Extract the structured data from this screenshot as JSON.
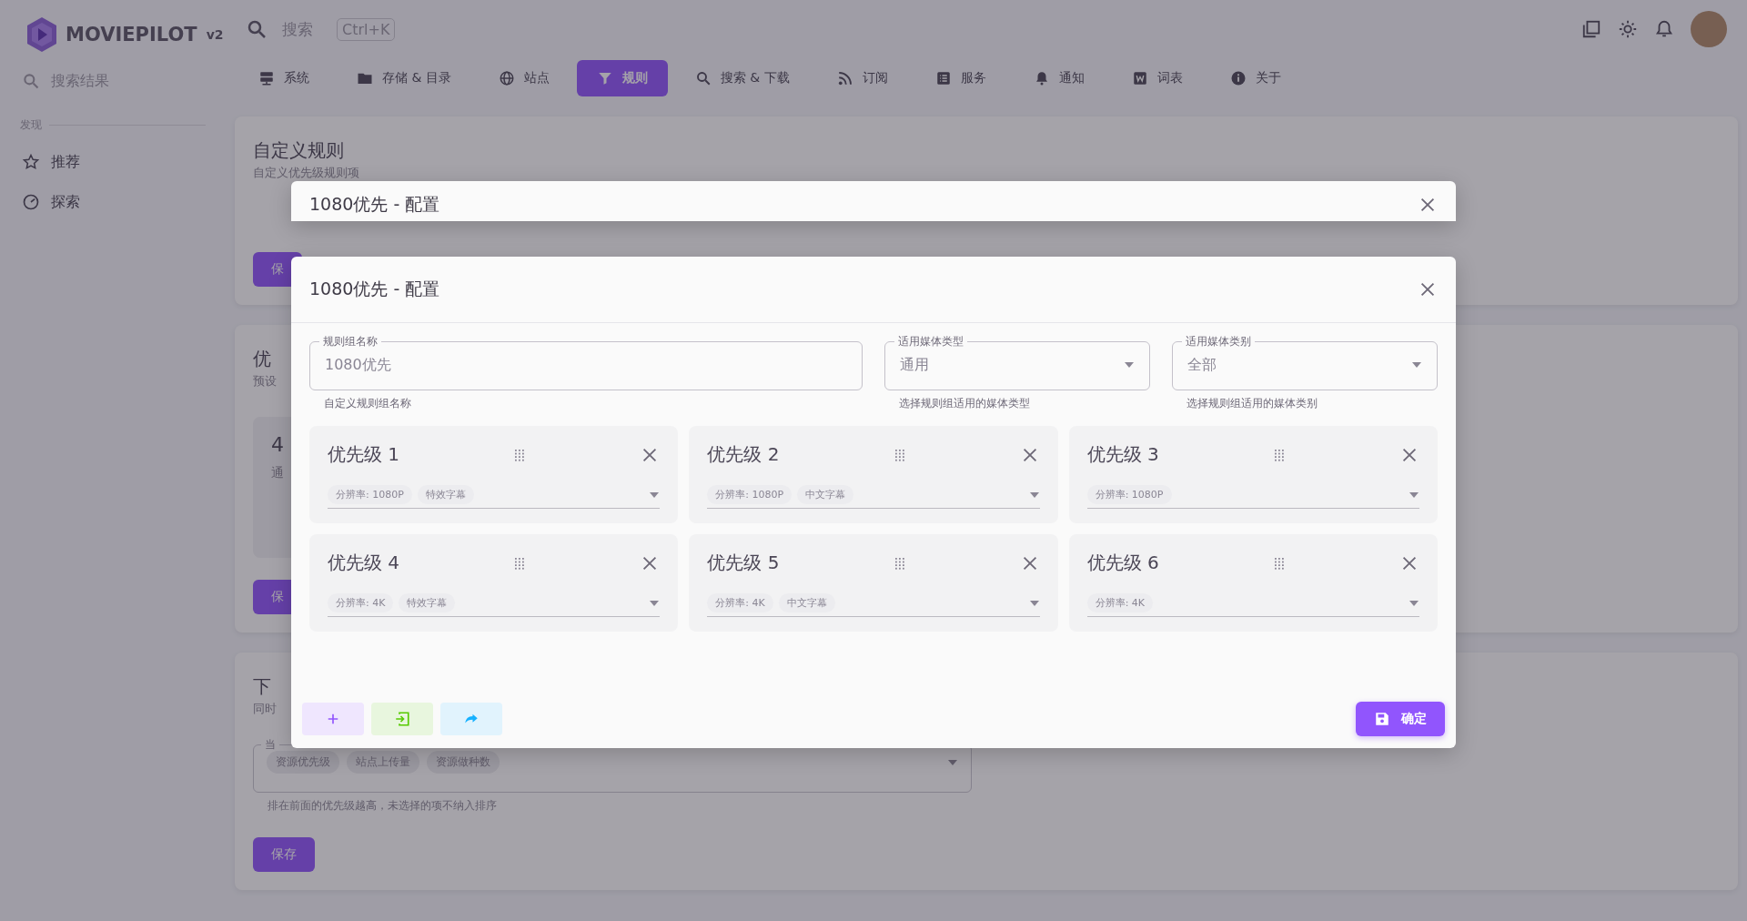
{
  "app": {
    "logo_text": "MOVIEPILOT",
    "version": "v2"
  },
  "search": {
    "placeholder": "搜索",
    "shortcut": "Ctrl+K"
  },
  "sidebar": {
    "placeholder": "搜索结果",
    "section": "发现",
    "items": [
      {
        "label": "推荐"
      },
      {
        "label": "探索"
      }
    ]
  },
  "tabs": [
    {
      "label": "系统",
      "selected": false
    },
    {
      "label": "存储 & 目录",
      "selected": false
    },
    {
      "label": "站点",
      "selected": false
    },
    {
      "label": "规则",
      "selected": true
    },
    {
      "label": "搜索 & 下载",
      "selected": false
    },
    {
      "label": "订阅",
      "selected": false
    },
    {
      "label": "服务",
      "selected": false
    },
    {
      "label": "通知",
      "selected": false
    },
    {
      "label": "词表",
      "selected": false
    },
    {
      "label": "关于",
      "selected": false
    }
  ],
  "cards": [
    {
      "title": "自定义规则",
      "subtitle": "自定义优先级规则项",
      "button": "保"
    },
    {
      "title": "优",
      "subtitle": "预设",
      "tile": {
        "value": "4",
        "text": "通"
      },
      "button": "保"
    },
    {
      "title": "下",
      "subtitle": "同时",
      "field": {
        "label": "当",
        "chips": [
          "资源优先级",
          "站点上传量",
          "资源做种数"
        ],
        "hint": "排在前面的优先级越高，未选择的项不纳入排序"
      },
      "button": "保存"
    }
  ],
  "back_dialog": {
    "title": "1080优先 - 配置"
  },
  "dialog": {
    "title": "1080优先 - 配置",
    "fields": [
      {
        "kind": "text",
        "label": "规则组名称",
        "value": "1080优先",
        "hint": "自定义规则组名称"
      },
      {
        "kind": "select",
        "label": "适用媒体类型",
        "value": "通用",
        "hint": "选择规则组适用的媒体类型"
      },
      {
        "kind": "select",
        "label": "适用媒体类别",
        "value": "全部",
        "hint": "选择规则组适用的媒体类别"
      }
    ],
    "priorities": [
      {
        "title": "优先级 1",
        "chips": [
          "分辨率: 1080P",
          "特效字幕"
        ]
      },
      {
        "title": "优先级 2",
        "chips": [
          "分辨率: 1080P",
          "中文字幕"
        ]
      },
      {
        "title": "优先级 3",
        "chips": [
          "分辨率: 1080P"
        ]
      },
      {
        "title": "优先级 4",
        "chips": [
          "分辨率: 4K",
          "特效字幕"
        ]
      },
      {
        "title": "优先级 5",
        "chips": [
          "分辨率: 4K",
          "中文字幕"
        ]
      },
      {
        "title": "优先级 6",
        "chips": [
          "分辨率: 4K"
        ]
      }
    ],
    "actions": [
      {
        "kind": "add"
      },
      {
        "kind": "import"
      },
      {
        "kind": "share"
      }
    ],
    "confirm": "确定"
  }
}
